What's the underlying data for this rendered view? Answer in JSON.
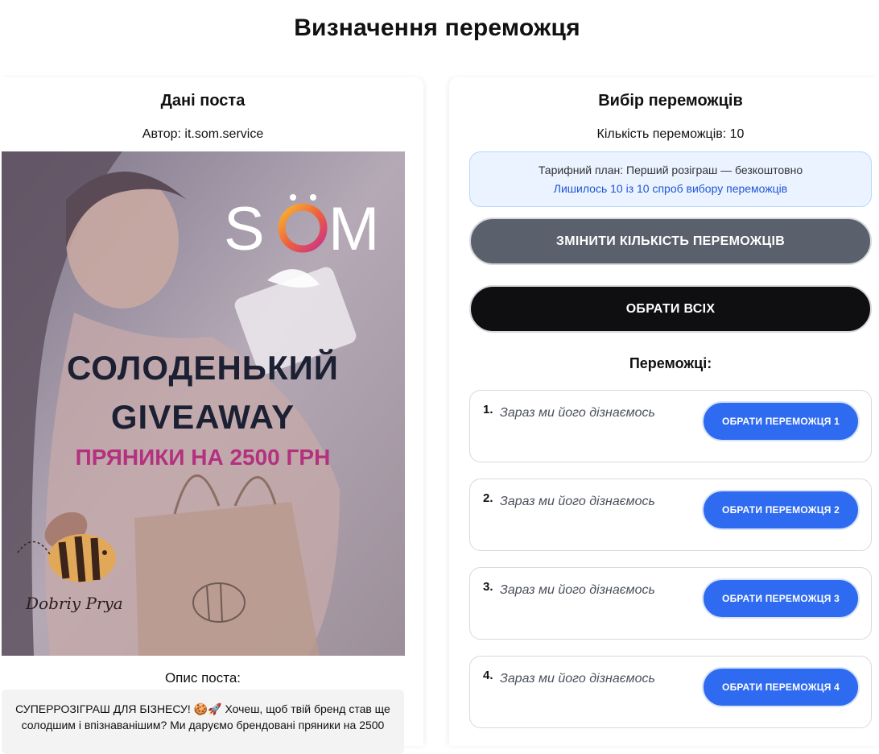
{
  "page": {
    "title": "Визначення переможця"
  },
  "post": {
    "section_title": "Дані поста",
    "author": "Автор: it.som.service",
    "image": {
      "brand_logo": "SÖM",
      "headline_line1": "СОЛОДЕНЬКИЙ",
      "headline_line2": "GIVEAWAY",
      "subline": "ПРЯНИКИ НА 2500 ГРН",
      "signature": "Dobriy Prya"
    },
    "description_label": "Опис поста:",
    "description_text": "СУПЕРРОЗІГРАШ ДЛЯ БІЗНЕСУ! 🍪🚀 Хочеш, щоб твій бренд став ще солодшим і впізнаванішим? Ми даруємо брендовані пряники на 2500"
  },
  "selection": {
    "section_title": "Вибір переможців",
    "count_text": "Кількість переможців: 10",
    "plan_text": "Тарифний план: Перший розіграш — безкоштовно",
    "attempts_text": "Лишилось 10 із 10 спроб вибору переможців",
    "change_count_button": "ЗМІНИТИ КІЛЬКІСТЬ ПЕРЕМОЖЦІВ",
    "select_all_button": "ОБРАТИ ВСІХ",
    "winners_label": "Переможці:",
    "winners": [
      {
        "number": "1.",
        "placeholder": "Зараз ми його дізнаємось",
        "button": "ОБРАТИ ПЕРЕМОЖЦЯ 1"
      },
      {
        "number": "2.",
        "placeholder": "Зараз ми його дізнаємось",
        "button": "ОБРАТИ ПЕРЕМОЖЦЯ 2"
      },
      {
        "number": "3.",
        "placeholder": "Зараз ми його дізнаємось",
        "button": "ОБРАТИ ПЕРЕМОЖЦЯ 3"
      },
      {
        "number": "4.",
        "placeholder": "Зараз ми його дізнаємось",
        "button": "ОБРАТИ ПЕРЕМОЖЦЯ 4"
      }
    ]
  },
  "colors": {
    "accent_blue": "#2f6bf0",
    "dark_button": "#0f0f11",
    "gray_button": "#5b606d",
    "plan_bg": "#eaf3ff",
    "headline_navy": "#1c2033",
    "subline_pink": "#b3317f"
  }
}
